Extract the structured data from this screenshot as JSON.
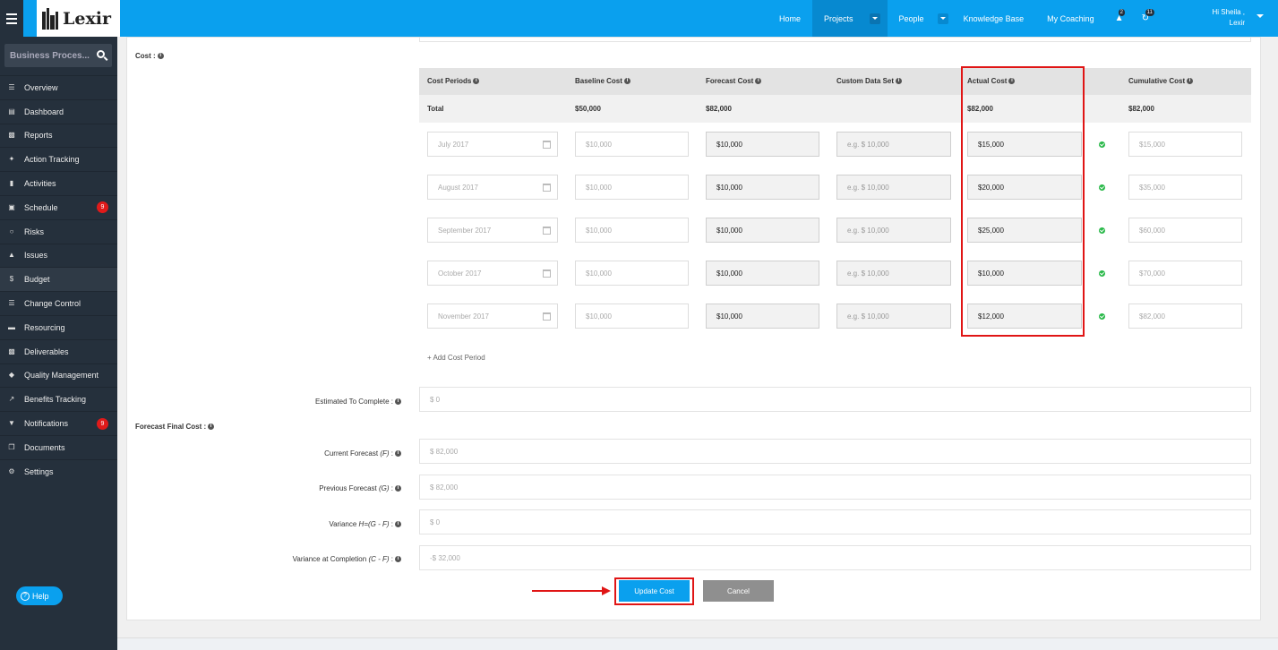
{
  "brand": {
    "logo_text": "Lexir"
  },
  "topnav": {
    "items": [
      "Home",
      "Projects",
      "People",
      "Knowledge Base",
      "My Coaching"
    ],
    "alerts_count": "2",
    "tasks_count": "11",
    "greeting": "Hi Sheila ,",
    "username": "Lexir"
  },
  "sidebar": {
    "search_placeholder": "Business Proces...",
    "items": [
      {
        "label": "Overview",
        "icon": "list-icon"
      },
      {
        "label": "Dashboard",
        "icon": "dashboard-icon"
      },
      {
        "label": "Reports",
        "icon": "bar-chart-icon"
      },
      {
        "label": "Action Tracking",
        "icon": "crosshair-icon"
      },
      {
        "label": "Activities",
        "icon": "bookmark-icon"
      },
      {
        "label": "Schedule",
        "icon": "calendar-icon",
        "badge": "9"
      },
      {
        "label": "Risks",
        "icon": "lightbulb-icon"
      },
      {
        "label": "Issues",
        "icon": "warning-icon"
      },
      {
        "label": "Budget",
        "icon": "dollar-icon"
      },
      {
        "label": "Change Control",
        "icon": "stack-icon"
      },
      {
        "label": "Resourcing",
        "icon": "folder-icon"
      },
      {
        "label": "Deliverables",
        "icon": "truck-icon"
      },
      {
        "label": "Quality Management",
        "icon": "tag-icon"
      },
      {
        "label": "Benefits Tracking",
        "icon": "line-chart-icon"
      },
      {
        "label": "Notifications",
        "icon": "bell-icon",
        "badge": "9"
      },
      {
        "label": "Documents",
        "icon": "copy-icon"
      },
      {
        "label": "Settings",
        "icon": "cogs-icon"
      }
    ],
    "help_label": "Help"
  },
  "cost": {
    "section_label": "Cost :",
    "headers": [
      "Cost Periods",
      "Baseline Cost",
      "Forecast Cost",
      "Custom Data Set",
      "Actual Cost",
      "Cumulative Cost"
    ],
    "total": {
      "label": "Total",
      "baseline": "$50,000",
      "forecast": "$82,000",
      "actual": "$82,000",
      "cumulative": "$82,000"
    },
    "rows": [
      {
        "period": "July 2017",
        "baseline": "$10,000",
        "forecast": "$10,000",
        "custom": "e.g. $ 10,000",
        "actual": "$15,000",
        "cumulative": "$15,000"
      },
      {
        "period": "August 2017",
        "baseline": "$10,000",
        "forecast": "$10,000",
        "custom": "e.g. $ 10,000",
        "actual": "$20,000",
        "cumulative": "$35,000"
      },
      {
        "period": "September 2017",
        "baseline": "$10,000",
        "forecast": "$10,000",
        "custom": "e.g. $ 10,000",
        "actual": "$25,000",
        "cumulative": "$60,000"
      },
      {
        "period": "October 2017",
        "baseline": "$10,000",
        "forecast": "$10,000",
        "custom": "e.g. $ 10,000",
        "actual": "$10,000",
        "cumulative": "$70,000"
      },
      {
        "period": "November 2017",
        "baseline": "$10,000",
        "forecast": "$10,000",
        "custom": "e.g. $ 10,000",
        "actual": "$12,000",
        "cumulative": "$82,000"
      }
    ],
    "add_period_label": "+ Add Cost Period"
  },
  "form": {
    "etc_label": "Estimated To Complete :",
    "etc_value": "$ 0",
    "ffc_label": "Forecast Final Cost :",
    "current_label": "Current Forecast",
    "current_suffix": "(F)",
    "current_value": "$ 82,000",
    "previous_label": "Previous Forecast",
    "previous_suffix": "(G)",
    "previous_value": "$ 82,000",
    "variance_label": "Variance",
    "variance_suffix": "H=(G - F)",
    "variance_value": "$ 0",
    "vac_label": "Variance at Completion",
    "vac_suffix": "(C - F)",
    "vac_value": "-$ 32,000"
  },
  "buttons": {
    "update": "Update Cost",
    "cancel": "Cancel"
  },
  "colors": {
    "primary": "#0aa0ee",
    "sidebar": "#25303c",
    "highlight": "#e01515",
    "success": "#2ab94a"
  }
}
